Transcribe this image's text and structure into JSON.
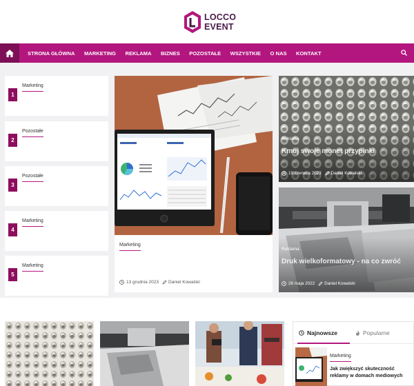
{
  "brand": {
    "line1": "LOCCO",
    "line2": "EVENT",
    "colors": {
      "primary": "#b3167e",
      "dark": "#7d0f57",
      "number": "#8e0d5e"
    }
  },
  "nav": {
    "home_icon": "home-icon",
    "search_icon": "search-icon",
    "items": [
      {
        "label": "STRONA GŁÓWNA"
      },
      {
        "label": "MARKETING"
      },
      {
        "label": "REKLAMA"
      },
      {
        "label": "BIZNES"
      },
      {
        "label": "POZOSTAŁE"
      },
      {
        "label": "WSZYSTKIE"
      },
      {
        "label": "O NAS"
      },
      {
        "label": "KONTAKT"
      }
    ]
  },
  "numbered_list": [
    {
      "number": "1",
      "category": "Marketing"
    },
    {
      "number": "2",
      "category": "Pozostałe"
    },
    {
      "number": "3",
      "category": "Pozostałe"
    },
    {
      "number": "4",
      "category": "Marketing"
    },
    {
      "number": "5",
      "category": "Marketing"
    }
  ],
  "featured": {
    "category": "Marketing",
    "date": "13 grudnia 2023",
    "author": "Daniel Kowalski"
  },
  "side_posts": [
    {
      "category": "Reklama",
      "title": "Kmuj swoje monet przypinki",
      "date": "19 czerwca 2023",
      "author": "Daniel Kowalski"
    },
    {
      "category": "Reklama",
      "title": "Druk wielkoformatowy - na co zwróć",
      "date": "26 maja 2022",
      "author": "Daniel Kowalski"
    }
  ],
  "tabs": {
    "newest": "Najnowsze",
    "popular": "Popularne",
    "post": {
      "category": "Marketing",
      "title": "Jak zwiększyć skuteczność reklamy w domach mediowych"
    }
  }
}
